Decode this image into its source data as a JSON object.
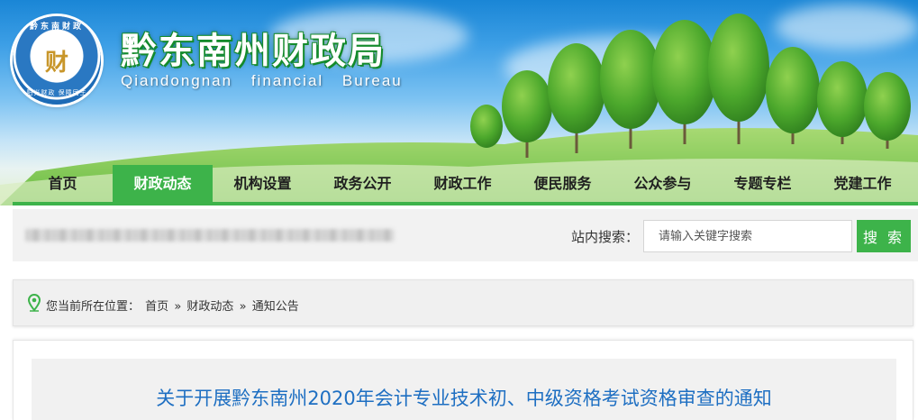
{
  "header": {
    "title": "黔东南州财政局",
    "subtitle": "Qiandongnan financial Bureau",
    "logo": {
      "ring_top": "黔东南财政",
      "center_glyph": "财",
      "ring_bottom": "阳光财政 保障民生"
    }
  },
  "nav": {
    "items": [
      {
        "label": "首页"
      },
      {
        "label": "财政动态"
      },
      {
        "label": "机构设置"
      },
      {
        "label": "政务公开"
      },
      {
        "label": "财政工作"
      },
      {
        "label": "便民服务"
      },
      {
        "label": "公众参与"
      },
      {
        "label": "专题专栏"
      },
      {
        "label": "党建工作"
      }
    ],
    "active_index": 1
  },
  "search": {
    "label": "站内搜索：",
    "placeholder": "请输入关键字搜索",
    "button": "搜 索"
  },
  "breadcrumb": {
    "prefix": "您当前所在位置：",
    "items": [
      "首页",
      "财政动态",
      "通知公告"
    ],
    "separator": "»"
  },
  "article": {
    "title": "关于开展黔东南州2020年会计专业技术初、中级资格考试资格审查的通知"
  },
  "colors": {
    "accent_green": "#3db34a",
    "title_blue": "#1e6fc2",
    "header_title_outline": "#138a2b"
  }
}
